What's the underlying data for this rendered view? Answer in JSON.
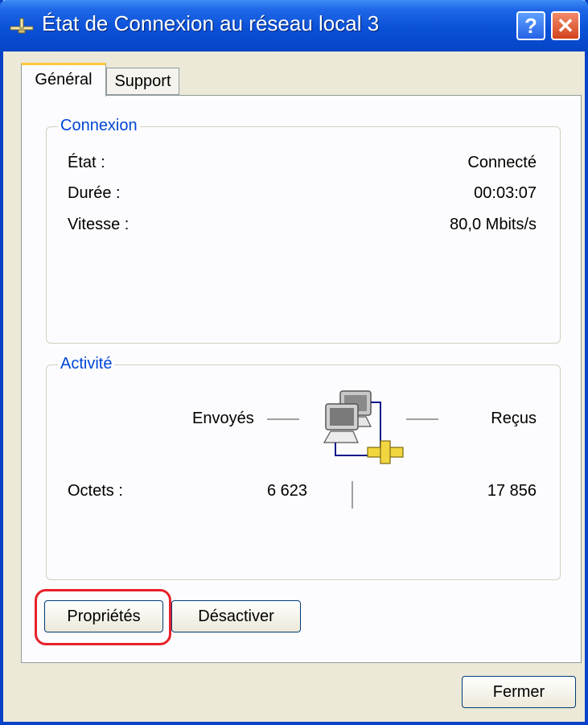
{
  "window": {
    "title": "État de Connexion au réseau local 3",
    "help_label": "?",
    "close_label": "✕",
    "icon": "network-connection-icon"
  },
  "tabs": [
    {
      "label": "Général",
      "selected": true
    },
    {
      "label": "Support",
      "selected": false
    }
  ],
  "connexion": {
    "legend": "Connexion",
    "rows": [
      {
        "label": "État :",
        "value": "Connecté"
      },
      {
        "label": "Durée :",
        "value": "00:03:07"
      },
      {
        "label": "Vitesse :",
        "value": "80,0 Mbits/s"
      }
    ]
  },
  "activite": {
    "legend": "Activité",
    "sent_label": "Envoyés",
    "received_label": "Reçus",
    "bytes_label": "Octets :",
    "bytes_sent": "6 623",
    "bytes_received": "17 856",
    "icon": "network-computers-icon"
  },
  "buttons": {
    "properties": "Propriétés",
    "disable": "Désactiver",
    "close": "Fermer"
  },
  "colors": {
    "title_bar": "#0a51d8",
    "legend_text": "#0046d5",
    "highlight": "#e8202a",
    "tab_accent": "#ffc83c"
  }
}
